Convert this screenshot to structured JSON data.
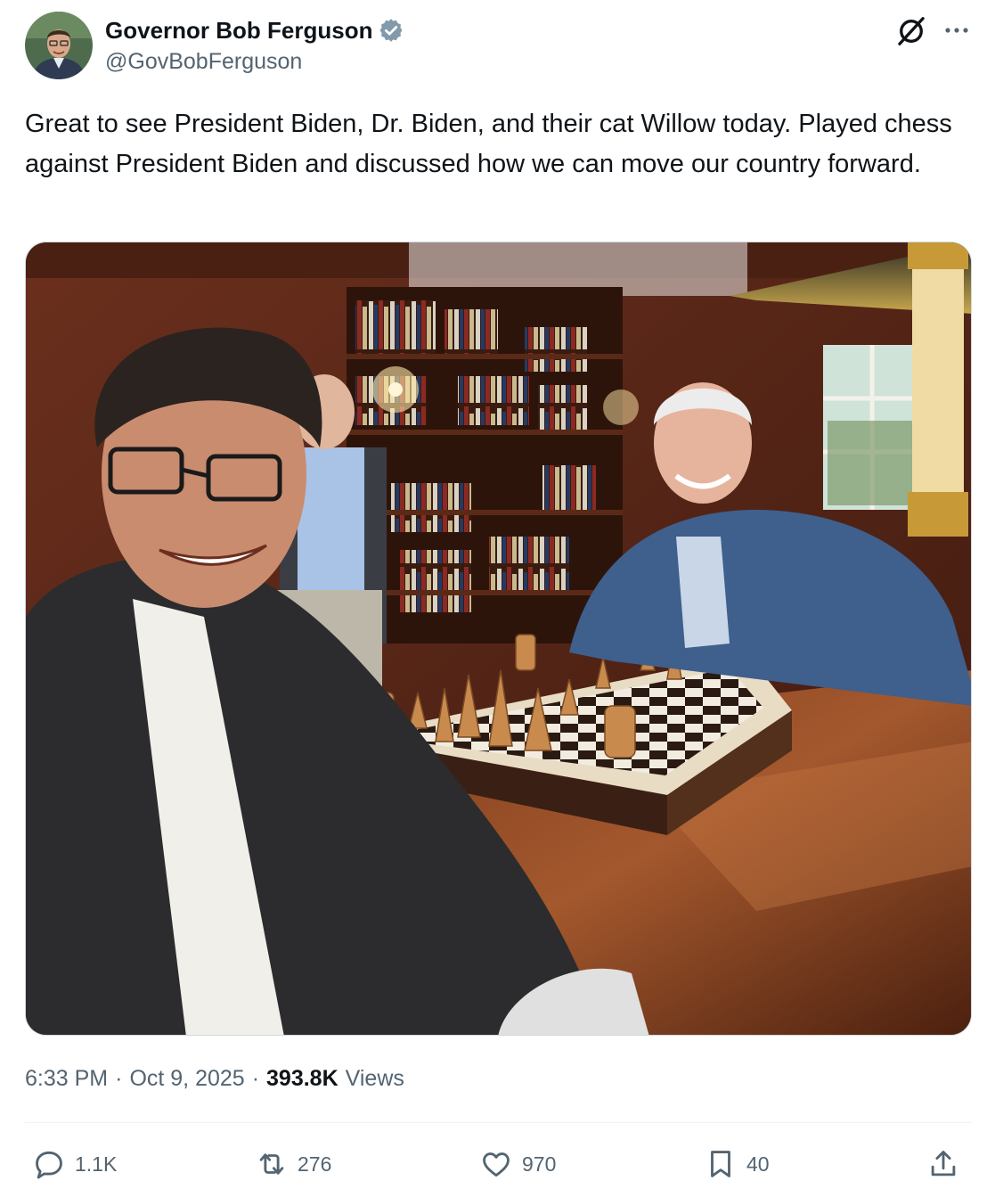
{
  "author": {
    "display_name": "Governor Bob Ferguson",
    "handle": "@GovBobFerguson",
    "verified": true,
    "avatar_icon": "profile-photo"
  },
  "header_icons": {
    "grok": "grok-icon",
    "more": "more-icon"
  },
  "tweet": {
    "text": "Great to see President Biden, Dr. Biden, and their cat Willow today. Played chess against President Biden and discussed how we can move our country forward."
  },
  "media": {
    "type": "photo",
    "icon": "photo-image"
  },
  "meta": {
    "time": "6:33 PM",
    "dot": "·",
    "date": "Oct 9, 2025",
    "views_count": "393.8K",
    "views_label": "Views"
  },
  "actions": {
    "reply_count": "1.1K",
    "repost_count": "276",
    "like_count": "970",
    "bookmark_count": "40"
  },
  "colors": {
    "text_primary": "#0f1419",
    "text_secondary": "#536471",
    "verified_blue": "#829aab",
    "divider": "#eff3f4"
  }
}
